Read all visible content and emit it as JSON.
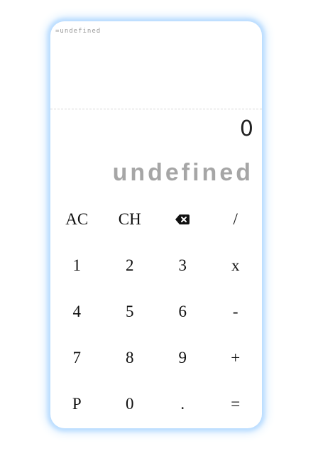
{
  "display": {
    "history": "=undefined",
    "current": "0",
    "result": "undefined"
  },
  "keys": [
    {
      "label": "AC",
      "name": "all-clear-button"
    },
    {
      "label": "CH",
      "name": "clear-history-button"
    },
    {
      "label": "",
      "name": "backspace-button",
      "icon": "backspace-icon"
    },
    {
      "label": "/",
      "name": "divide-button"
    },
    {
      "label": "1",
      "name": "digit-1-button"
    },
    {
      "label": "2",
      "name": "digit-2-button"
    },
    {
      "label": "3",
      "name": "digit-3-button"
    },
    {
      "label": "x",
      "name": "multiply-button"
    },
    {
      "label": "4",
      "name": "digit-4-button"
    },
    {
      "label": "5",
      "name": "digit-5-button"
    },
    {
      "label": "6",
      "name": "digit-6-button"
    },
    {
      "label": "-",
      "name": "subtract-button"
    },
    {
      "label": "7",
      "name": "digit-7-button"
    },
    {
      "label": "8",
      "name": "digit-8-button"
    },
    {
      "label": "9",
      "name": "digit-9-button"
    },
    {
      "label": "+",
      "name": "add-button"
    },
    {
      "label": "P",
      "name": "p-button"
    },
    {
      "label": "0",
      "name": "digit-0-button"
    },
    {
      "label": ".",
      "name": "decimal-point-button"
    },
    {
      "label": "=",
      "name": "equals-button"
    }
  ],
  "colors": {
    "glow": "#b9dcff",
    "result_text": "#a6a6a6",
    "key_text": "#111111"
  }
}
